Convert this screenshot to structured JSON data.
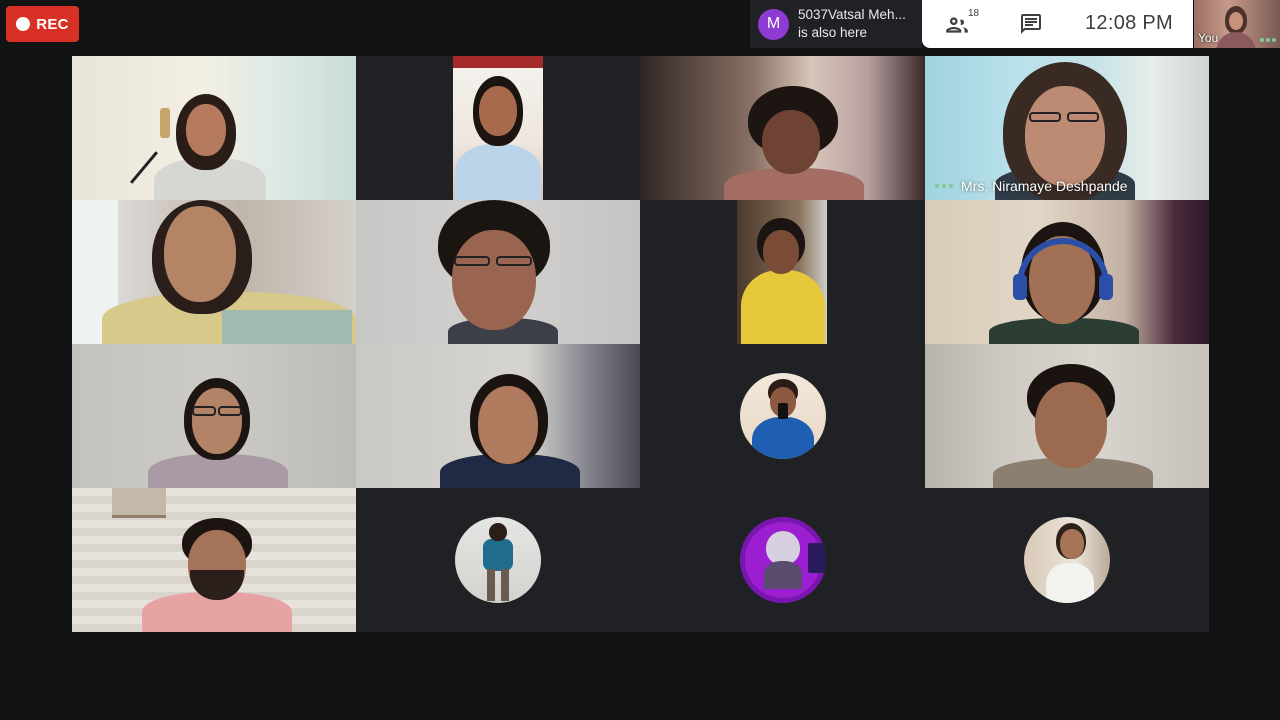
{
  "recording": {
    "label": "REC"
  },
  "join_toast": {
    "avatar_letter": "M",
    "name": "5037Vatsal Meh...",
    "message": "is also here"
  },
  "topbar": {
    "participant_count": "18",
    "time": "12:08  PM",
    "people_icon": "people-icon",
    "chat_icon": "chat-icon"
  },
  "self_view": {
    "label": "You"
  },
  "participants": {
    "active_speaker": {
      "name": "Mrs. Niramaye Deshpande"
    }
  },
  "colors": {
    "rec_red": "#d93025",
    "background": "#111214",
    "tile_bg": "#202124",
    "active_speaker_accent": "#5ec8c2",
    "audio_dots": "#81c995",
    "toast_avatar": "#8e3bd4"
  }
}
